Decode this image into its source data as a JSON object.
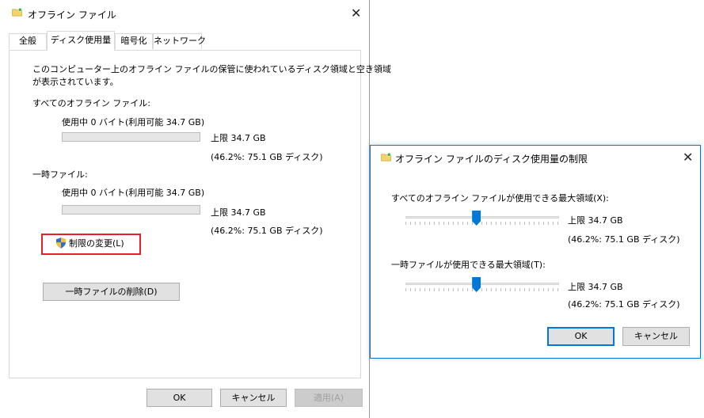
{
  "main_window": {
    "title": "オフライン ファイル",
    "tabs": [
      "全般",
      "ディスク使用量",
      "暗号化",
      "ネットワーク"
    ],
    "active_tab_index": 1,
    "description_line1": "このコンピューター上のオフライン ファイルの保管に使われているディスク領域と空き領域",
    "description_line2": "が表示されています。",
    "all_files": {
      "heading": "すべてのオフライン ファイル:",
      "usage": "使用中 0 バイト(利用可能 34.7 GB)",
      "usage_fraction": 0,
      "limit": "上限 34.7 GB",
      "limit_detail": "(46.2%: 75.1 GB ディスク)"
    },
    "temp_files": {
      "heading": "一時ファイル:",
      "usage": "使用中 0 バイト(利用可能 34.7 GB)",
      "usage_fraction": 0,
      "limit": "上限 34.7 GB",
      "limit_detail": "(46.2%: 75.1 GB ディスク)"
    },
    "change_limits_button": "制限の変更(L)",
    "delete_temp_button": "一時ファイルの削除(D)",
    "ok_button": "OK",
    "cancel_button": "キャンセル",
    "apply_button": "適用(A)"
  },
  "dialog": {
    "title": "オフライン ファイルのディスク使用量の制限",
    "all_files_label": "すべてのオフライン ファイルが使用できる最大領域(X):",
    "all_files_limit": "上限 34.7 GB",
    "all_files_detail": "(46.2%: 75.1 GB ディスク)",
    "all_files_slider_percent": 46.2,
    "temp_files_label": "一時ファイルが使用できる最大領域(T):",
    "temp_files_limit": "上限 34.7 GB",
    "temp_files_detail": "(46.2%: 75.1 GB ディスク)",
    "temp_files_slider_percent": 46.2,
    "ok_button": "OK",
    "cancel_button": "キャンセル"
  },
  "colors": {
    "accent": "#0078d7",
    "highlight_box": "#e4202a",
    "window_border": "#7a7a7a"
  }
}
